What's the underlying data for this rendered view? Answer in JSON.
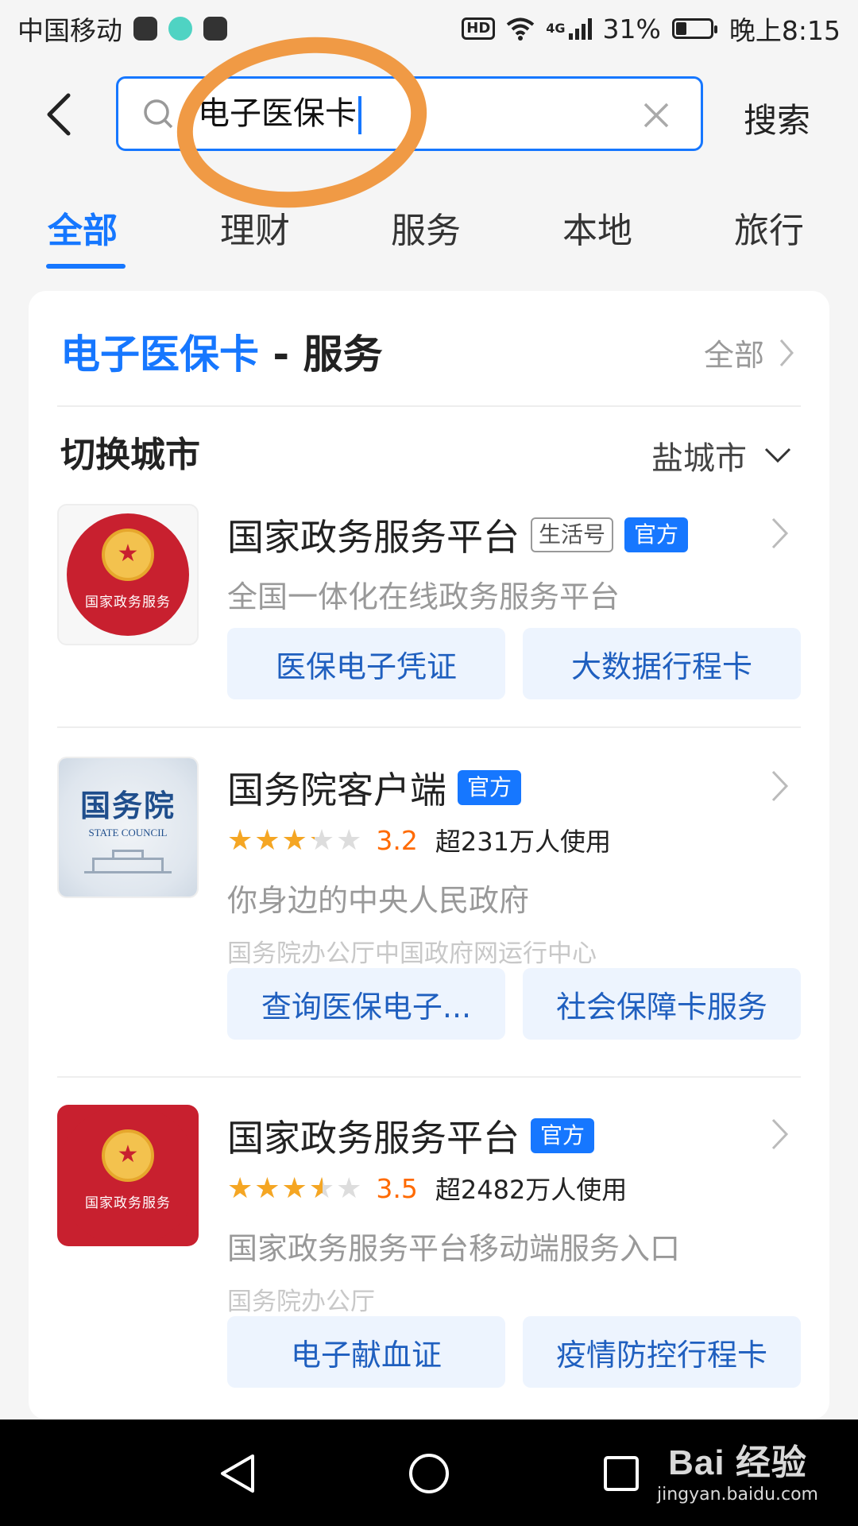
{
  "statusbar": {
    "carrier": "中国移动",
    "hd": "HD",
    "net": "4G",
    "battery": "31%",
    "battery_level": 0.31,
    "time": "晚上8:15"
  },
  "search": {
    "query": "电子医保卡",
    "submit": "搜索"
  },
  "tabs": [
    {
      "label": "全部",
      "active": true
    },
    {
      "label": "理财"
    },
    {
      "label": "服务"
    },
    {
      "label": "本地"
    },
    {
      "label": "旅行"
    }
  ],
  "section": {
    "keyword": "电子医保卡",
    "suffix": " - 服务",
    "more": "全部"
  },
  "city": {
    "label": "切换城市",
    "current": "盐城市"
  },
  "items": [
    {
      "name": "国家政务服务平台",
      "logo_text": "国家政务服务",
      "tag_life": "生活号",
      "tag_official": "官方",
      "desc": "全国一体化在线政务服务平台",
      "actions": [
        "医保电子凭证",
        "大数据行程卡"
      ]
    },
    {
      "name": "国务院客户端",
      "logo_cn": "国务院",
      "logo_en": "STATE COUNCIL",
      "tag_official": "官方",
      "rating": 3.2,
      "rating_text": "3.2",
      "users": "超231万人使用",
      "desc": "你身边的中央人民政府",
      "sub": "国务院办公厅中国政府网运行中心",
      "actions": [
        "查询医保电子...",
        "社会保障卡服务"
      ]
    },
    {
      "name": "国家政务服务平台",
      "logo_text": "国家政务服务",
      "tag_official": "官方",
      "rating": 3.5,
      "rating_text": "3.5",
      "users": "超2482万人使用",
      "desc": "国家政务服务平台移动端服务入口",
      "sub": "国务院办公厅",
      "actions": [
        "电子献血证",
        "疫情防控行程卡"
      ]
    }
  ],
  "watermark": {
    "brand": "Bai 经验",
    "url": "jingyan.baidu.com"
  },
  "colors": {
    "accent": "#1677ff",
    "highlight": "#f09a45",
    "star": "#f5a623",
    "score": "#ff6a00"
  },
  "icons": [
    "back-arrow-icon",
    "search-icon",
    "clear-icon",
    "chevron-right-icon",
    "chevron-down-icon",
    "nav-back-icon",
    "nav-home-icon",
    "nav-recent-icon"
  ]
}
